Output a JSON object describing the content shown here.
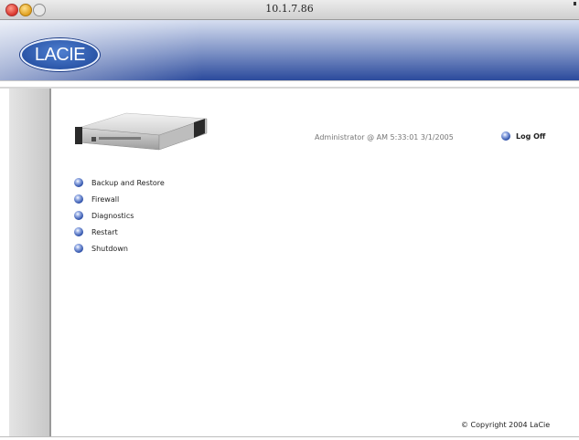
{
  "window": {
    "title": "10.1.7.86"
  },
  "header": {
    "logo_text": "LACIE",
    "brand_color": "#2b4a9c"
  },
  "session": {
    "user_text": "Administrator  @    AM 5:33:01  3/1/2005",
    "logoff_label": "Log Off"
  },
  "menu": {
    "items": [
      {
        "label": "Backup and Restore"
      },
      {
        "label": "Firewall"
      },
      {
        "label": "Diagnostics"
      },
      {
        "label": "Restart"
      },
      {
        "label": "Shutdown"
      }
    ],
    "bullet_icon": "blue-orb-icon"
  },
  "footer": {
    "copyright": "© Copyright 2004 LaCie"
  }
}
